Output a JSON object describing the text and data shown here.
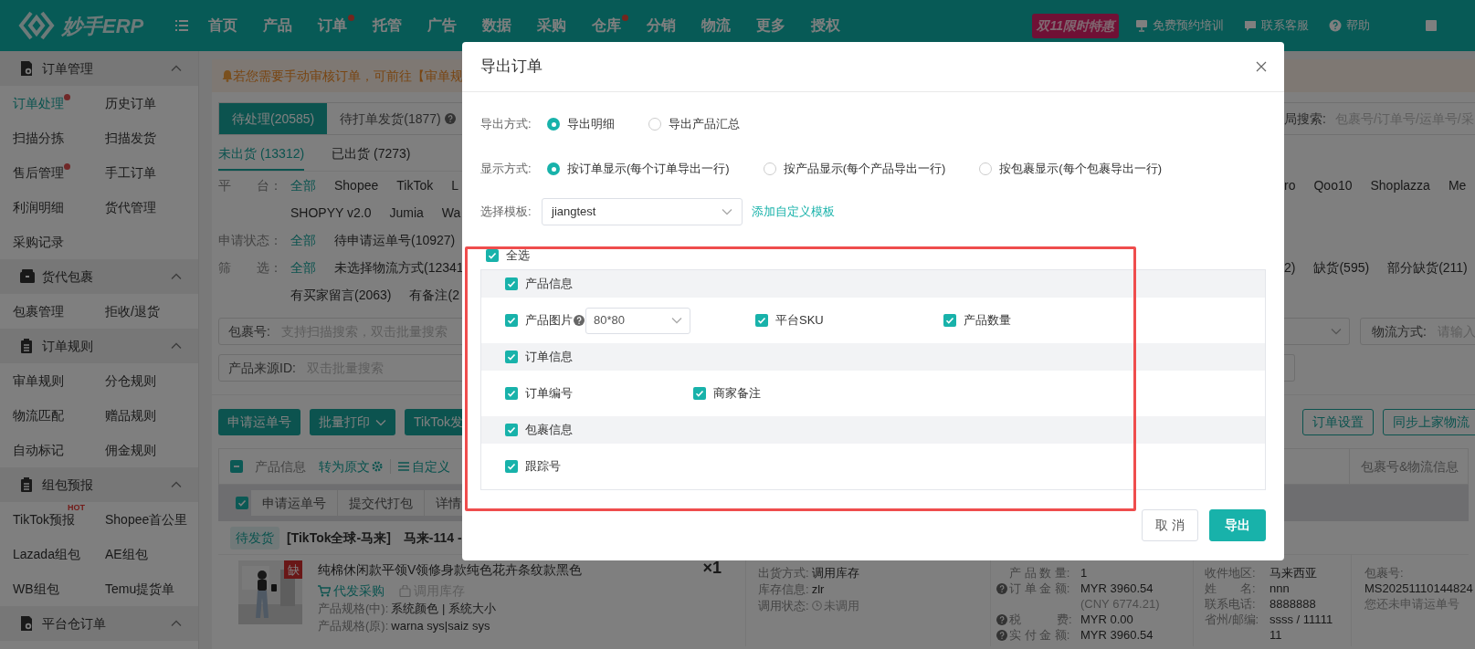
{
  "topbar": {
    "logo": "妙手ERP",
    "nav": [
      {
        "label": "首页",
        "dot": false
      },
      {
        "label": "产品",
        "dot": false
      },
      {
        "label": "订单",
        "dot": true
      },
      {
        "label": "托管",
        "dot": false
      },
      {
        "label": "广告",
        "dot": false
      },
      {
        "label": "数据",
        "dot": false
      },
      {
        "label": "采购",
        "dot": false
      },
      {
        "label": "仓库",
        "dot": true
      },
      {
        "label": "分销",
        "dot": false
      },
      {
        "label": "物流",
        "dot": false
      },
      {
        "label": "更多",
        "dot": false
      },
      {
        "label": "授权",
        "dot": false
      }
    ],
    "promo": "双11限时特惠",
    "links": [
      {
        "label": "免费预约培训",
        "kind": "training"
      },
      {
        "label": "联系客服",
        "kind": "chat"
      },
      {
        "label": "帮助",
        "kind": "help"
      }
    ]
  },
  "sidebar": [
    {
      "title": "订单管理",
      "kind": "doc",
      "expanded": true,
      "items": [
        {
          "label": "订单处理",
          "selected": true,
          "dot": true
        },
        {
          "label": "历史订单",
          "selected": false,
          "dot": false
        },
        {
          "label": "扫描分拣",
          "selected": false,
          "dot": false
        },
        {
          "label": "扫描发货",
          "selected": false,
          "dot": false
        },
        {
          "label": "售后管理",
          "selected": false,
          "dot": true
        },
        {
          "label": "手工订单",
          "selected": false,
          "dot": false
        },
        {
          "label": "利润明细",
          "selected": false,
          "dot": false
        },
        {
          "label": "货代管理",
          "selected": false,
          "dot": false
        },
        {
          "label": "采购记录",
          "selected": false,
          "dot": false
        }
      ]
    },
    {
      "title": "货代包裹",
      "kind": "box",
      "expanded": true,
      "items": [
        {
          "label": "包裹管理",
          "selected": false,
          "dot": false
        },
        {
          "label": "拒收/退货",
          "selected": false,
          "dot": false
        }
      ]
    },
    {
      "title": "订单规则",
      "kind": "clipboard",
      "expanded": true,
      "items": [
        {
          "label": "审单规则",
          "selected": false,
          "dot": false
        },
        {
          "label": "分仓规则",
          "selected": false,
          "dot": false
        },
        {
          "label": "物流匹配",
          "selected": false,
          "dot": false
        },
        {
          "label": "赠品规则",
          "selected": false,
          "dot": false
        },
        {
          "label": "自动标记",
          "selected": false,
          "dot": false
        },
        {
          "label": "佣金规则",
          "selected": false,
          "dot": false
        }
      ]
    },
    {
      "title": "组包预报",
      "kind": "clipboard",
      "expanded": true,
      "items": [
        {
          "label": "TikTok预报",
          "selected": false,
          "dot": false,
          "badge": "HOT"
        },
        {
          "label": "Shopee首公里",
          "selected": false,
          "dot": false
        },
        {
          "label": "Lazada组包",
          "selected": false,
          "dot": false
        },
        {
          "label": "AE组包",
          "selected": false,
          "dot": false
        },
        {
          "label": "WB组包",
          "selected": false,
          "dot": false
        },
        {
          "label": "Temu提货单",
          "selected": false,
          "dot": false
        }
      ]
    },
    {
      "title": "平台仓订单",
      "kind": "doc",
      "expanded": true
    }
  ],
  "notice": "若您需要手动审核订单，可前往【审单规",
  "status_tabs": [
    {
      "label": "待处理(20585)",
      "selected": true,
      "help": false
    },
    {
      "label": "待打单发货(1877)",
      "selected": false,
      "help": true
    }
  ],
  "global_search": {
    "label": "局搜索:",
    "placeholder": "包裹号/订单号/运单号/采"
  },
  "ship_tabs": [
    {
      "label": "未出货 (13312)",
      "selected": true
    },
    {
      "label": "已出货 (7273)",
      "selected": false
    }
  ],
  "filters": [
    {
      "label": "平　　台：",
      "options": [
        {
          "label": "全部",
          "selected": true
        },
        {
          "label": "Shopee",
          "selected": false
        },
        {
          "label": "TikTok",
          "selected": false
        },
        {
          "label": "L",
          "selected": false
        }
      ],
      "right": [
        {
          "label": "ro",
          "selected": false
        },
        {
          "label": "Qoo10",
          "selected": false
        },
        {
          "label": "Shoplazza",
          "selected": false
        },
        {
          "label": "Me",
          "selected": false
        }
      ]
    },
    {
      "options": [
        {
          "label": "SHOPYY v2.0",
          "selected": false
        },
        {
          "label": "Jumia",
          "selected": false
        },
        {
          "label": "Wa",
          "selected": false
        }
      ]
    },
    {
      "label": "申请状态：",
      "options": [
        {
          "label": "全部",
          "selected": true
        },
        {
          "label": "待申请运单号(10927)",
          "selected": false
        }
      ]
    },
    {
      "label": "筛　　选：",
      "options": [
        {
          "label": "全部",
          "selected": true
        },
        {
          "label": "未选择物流方式(12341",
          "selected": false
        }
      ],
      "right": [
        {
          "label": "2)",
          "selected": false
        },
        {
          "label": "缺货(595)",
          "selected": false
        },
        {
          "label": "部分缺货(211)",
          "selected": false
        }
      ]
    },
    {
      "options": [
        {
          "label": "有买家留言(2063)",
          "selected": false
        },
        {
          "label": "有备注(2",
          "selected": false
        }
      ]
    }
  ],
  "search_fields": [
    {
      "label": "包裹号:",
      "placeholder": "支持扫描搜索，双击批量搜索"
    },
    {
      "label": "产品来源ID:",
      "placeholder": "双击批量搜索"
    }
  ],
  "logistics_field": {
    "label": "物流方式:",
    "placeholder": "请输入"
  },
  "actions": [
    {
      "label": "申请运单号",
      "kind": "primary"
    },
    {
      "label": "批量打印",
      "kind": "dropdown"
    },
    {
      "label": "TikTok发",
      "kind": "primary"
    }
  ],
  "actions_right": [
    {
      "label": "订单设置"
    },
    {
      "label": "同步上家物流"
    }
  ],
  "table": {
    "indeterminate": true,
    "product_column": "产品信息",
    "translate_link": "转为原文",
    "custom_link": "自定义",
    "package_column": "包裹号&物流信息",
    "bulk_checked": true,
    "bulk_buttons": [
      {
        "label": "申请运单号"
      },
      {
        "label": "提交代打包"
      },
      {
        "label": "详情"
      }
    ]
  },
  "order": {
    "status": "待发货",
    "store": "[TikTok全球-马来]",
    "title": "马来-114 -",
    "product": {
      "stock_tag": "缺",
      "title": "纯棉休闲款平领V领修身款纯色花卉条纹款黑色",
      "quantity": "×1",
      "actions": [
        {
          "label": "代发采购",
          "disabled": false,
          "kind": "cart"
        },
        {
          "label": "调用库存",
          "disabled": true,
          "kind": "bag"
        }
      ],
      "specs": [
        {
          "label": "产品规格(中):",
          "value": "系统颜色 | 系统大小"
        },
        {
          "label": "产品规格(原):",
          "value": "warna sys|saiz sys"
        }
      ]
    },
    "shipping": [
      {
        "label": "出货方式:",
        "value": "调用库存",
        "kind": "plain"
      },
      {
        "label": "库存信息:",
        "value": "zlr",
        "kind": "plain"
      },
      {
        "label": "调用状态:",
        "value": "未调用",
        "kind": "clock"
      }
    ],
    "amounts": [
      {
        "label": "产 品 数 量:",
        "value": "1",
        "help": false
      },
      {
        "label": "订 单 金 额:",
        "value": "MYR 3960.54",
        "help": true,
        "sub": "(CNY 6774.21)"
      },
      {
        "label": "税　　　费:",
        "value": "MYR 0.00",
        "help": true
      },
      {
        "label": "实 付 金 额:",
        "value": "MYR 3960.54",
        "help": true
      }
    ],
    "recipient": [
      {
        "label": "收件地区:",
        "value": "马来西亚"
      },
      {
        "label": "姓　　名:",
        "value": "nnn"
      },
      {
        "label": "联系电话:",
        "value": "8888888"
      },
      {
        "label": "省州/邮编:",
        "value": "ssss / 11111 11"
      }
    ],
    "package": {
      "label": "包裹号:",
      "number": "MS20251110144824",
      "note": "您还未申请运单号"
    }
  },
  "modal": {
    "title": "导出订单",
    "export_mode": {
      "label": "导出方式:",
      "options": [
        {
          "label": "导出明细",
          "selected": true
        },
        {
          "label": "导出产品汇总",
          "selected": false
        }
      ]
    },
    "display_mode": {
      "label": "显示方式:",
      "options": [
        {
          "label": "按订单显示(每个订单导出一行)",
          "selected": true
        },
        {
          "label": "按产品显示(每个产品导出一行)",
          "selected": false
        },
        {
          "label": "按包裹显示(每个包裹导出一行)",
          "selected": false
        }
      ]
    },
    "template": {
      "label": "选择模板:",
      "value": "jiangtest",
      "link": "添加自定义模板"
    },
    "select_all": {
      "label": "全选",
      "checked": true
    },
    "groups": [
      {
        "title": "产品信息",
        "checked": true,
        "fields": [
          {
            "label": "产品图片",
            "checked": true,
            "size": "80*80"
          },
          {
            "label": "平台SKU",
            "checked": true,
            "kind": "plain"
          },
          {
            "label": "产品数量",
            "checked": true,
            "kind": "plain"
          }
        ]
      },
      {
        "title": "订单信息",
        "checked": true,
        "fields": [
          {
            "label": "订单编号",
            "checked": true,
            "kind": "plain"
          },
          {
            "label": "商家备注",
            "checked": true,
            "kind": "plain"
          }
        ]
      },
      {
        "title": "包裹信息",
        "checked": true,
        "fields": [
          {
            "label": "跟踪号",
            "checked": true,
            "kind": "plain"
          }
        ]
      }
    ],
    "buttons": [
      {
        "label": "取 消",
        "kind": "secondary"
      },
      {
        "label": "导出",
        "kind": "primary"
      }
    ]
  }
}
